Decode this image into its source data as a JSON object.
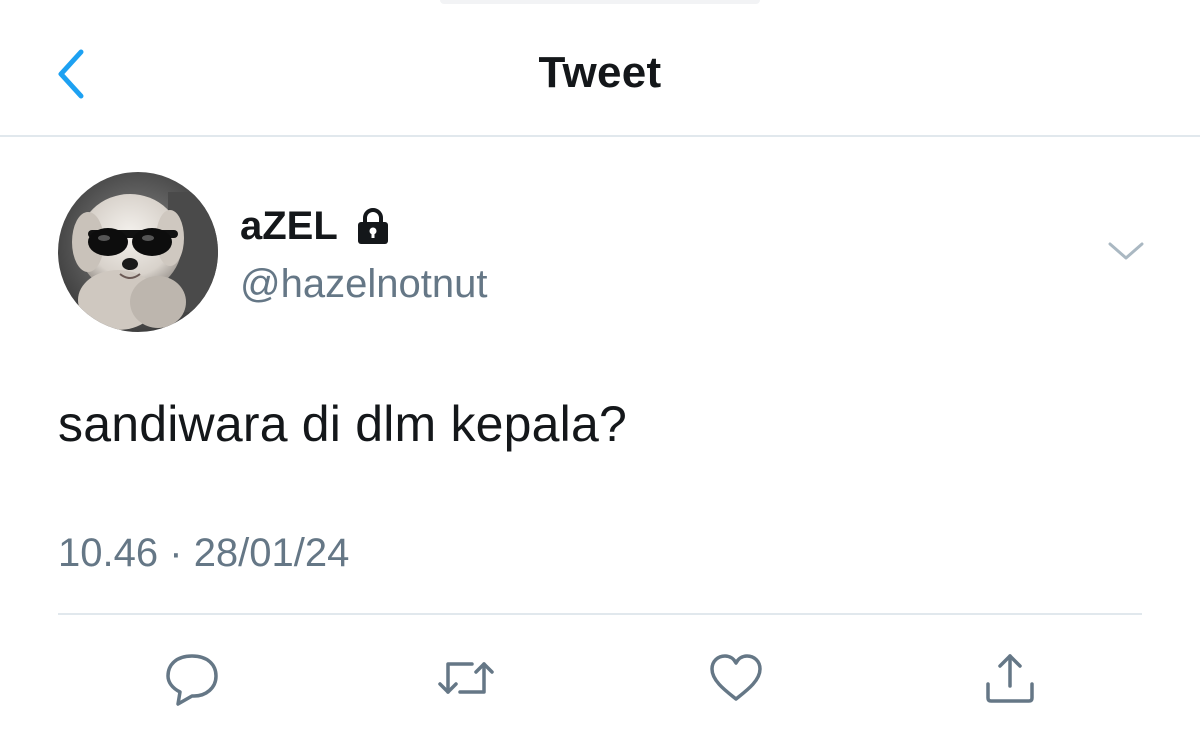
{
  "header": {
    "title": "Tweet",
    "back_icon": "chevron-left-icon"
  },
  "tweet": {
    "author": {
      "display_name": "aZEL",
      "handle": "@hazelnotnut",
      "protected_icon": "lock-icon"
    },
    "text": "sandiwara di dlm kepala?",
    "time": "10.46",
    "separator": "·",
    "date": "28/01/24"
  },
  "actions": [
    {
      "icon": "reply-icon"
    },
    {
      "icon": "retweet-icon"
    },
    {
      "icon": "like-icon"
    },
    {
      "icon": "share-icon"
    }
  ],
  "colors": {
    "accent": "#1da1f2",
    "text_primary": "#14171a",
    "text_secondary": "#657786",
    "divider": "#e1e8ed"
  }
}
